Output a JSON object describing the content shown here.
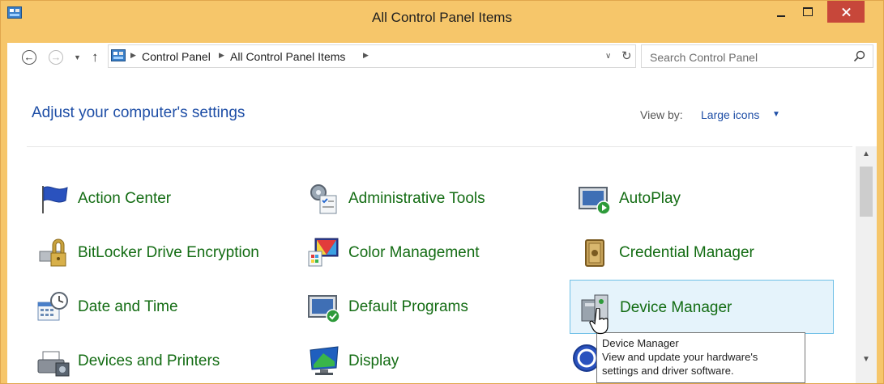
{
  "window": {
    "title": "All Control Panel Items",
    "accent": "#f6c66a"
  },
  "address_bar": {
    "breadcrumbs": [
      "Control Panel",
      "All Control Panel Items"
    ],
    "search_placeholder": "Search Control Panel"
  },
  "header": {
    "heading": "Adjust your computer's settings",
    "view_by_label": "View by:",
    "view_by_value": "Large icons"
  },
  "items": [
    {
      "label": "Action Center",
      "icon": "flag-icon"
    },
    {
      "label": "Administrative Tools",
      "icon": "admin-tools-icon"
    },
    {
      "label": "AutoPlay",
      "icon": "autoplay-icon"
    },
    {
      "label": "BitLocker Drive Encryption",
      "icon": "bitlocker-icon"
    },
    {
      "label": "Color Management",
      "icon": "color-management-icon"
    },
    {
      "label": "Credential Manager",
      "icon": "credential-vault-icon"
    },
    {
      "label": "Date and Time",
      "icon": "calendar-clock-icon"
    },
    {
      "label": "Default Programs",
      "icon": "default-programs-icon"
    },
    {
      "label": "Device Manager",
      "icon": "device-manager-icon",
      "hovered": true
    },
    {
      "label": "Devices and Printers",
      "icon": "printer-icon"
    },
    {
      "label": "Display",
      "icon": "display-icon"
    }
  ],
  "tooltip": {
    "title": "Device Manager",
    "line1": "View and update your hardware's",
    "line2": "settings and driver software."
  },
  "colors": {
    "link": "#1e4ea6",
    "item_label": "#136c13",
    "hover_border": "#70c0e7",
    "hover_bg": "#e5f3fb"
  }
}
